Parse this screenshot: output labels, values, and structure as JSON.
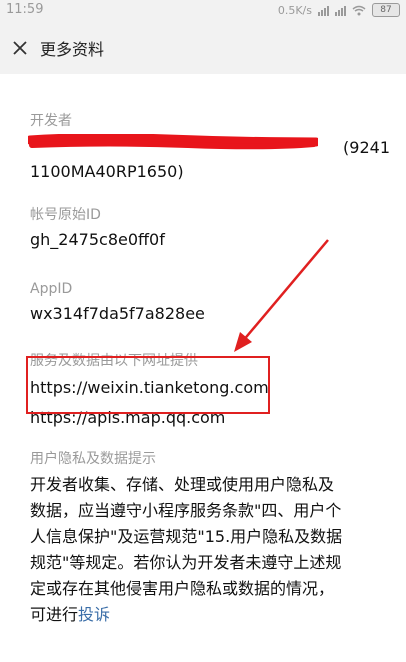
{
  "status_bar": {
    "time": "11:59",
    "network_speed": "0.5K/s",
    "battery_level": "87"
  },
  "header": {
    "title": "更多资料"
  },
  "developer": {
    "label": "开发者",
    "value_visible_start": "(9241",
    "value_line2": "1100MA40RP1650)"
  },
  "original_id": {
    "label": "帐号原始ID",
    "value": "gh_2475c8e0ff0f"
  },
  "appid": {
    "label": "AppID",
    "value": "wx314f7da5f7a828ee"
  },
  "service_domains": {
    "label": "服务及数据由以下网址提供",
    "urls": [
      "https://weixin.tianketong.com",
      "https://apis.map.qq.com"
    ]
  },
  "privacy": {
    "label": "用户隐私及数据提示",
    "lines": [
      "开发者收集、存储、处理或使用用户隐私及",
      "数据，应当遵守小程序服务条款\"四、用户个",
      "人信息保护\"及运营规范\"15.用户隐私及数据",
      "规范\"等规定。若你认为开发者未遵守上述规",
      "定或存在其他侵害用户隐私或数据的情况，"
    ],
    "last_line_prefix": "可进行",
    "report_link": "投诉"
  },
  "colors": {
    "annotation_red": "#e02020",
    "link_blue": "#3b6ea8",
    "header_bg": "#f2f2f2"
  }
}
